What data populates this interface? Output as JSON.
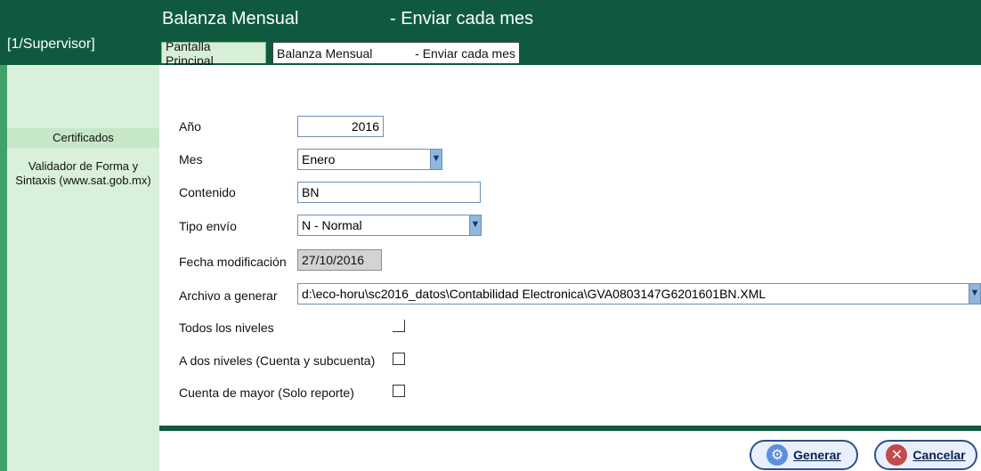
{
  "header": {
    "title_left": "Balanza Mensual",
    "title_right": "- Enviar cada mes",
    "user_label": "[1/Supervisor]"
  },
  "tabs": [
    {
      "label": "Pantalla Principal"
    },
    {
      "label_left": "Balanza Mensual",
      "label_right": "- Enviar cada mes"
    }
  ],
  "sidebar": {
    "items": [
      {
        "label": "Certificados"
      },
      {
        "label": "Validador de Forma y Sintaxis (www.sat.gob.mx)"
      }
    ]
  },
  "form": {
    "year_label": "Año",
    "year_value": "2016",
    "month_label": "Mes",
    "month_value": "Enero",
    "content_label": "Contenido",
    "content_value": "BN",
    "send_type_label": "Tipo envío",
    "send_type_value": "N - Normal",
    "modified_label": "Fecha modificación",
    "modified_value": "27/10/2016",
    "file_label": "Archivo a generar",
    "file_value": "d:\\eco-horu\\sc2016_datos\\Contabilidad Electronica\\GVA0803147G6201601BN.XML",
    "opt_all_levels": "Todos los niveles",
    "opt_two_levels": "A dos niveles (Cuenta y subcuenta)",
    "opt_major_account": "Cuenta de mayor (Solo reporte)"
  },
  "buttons": {
    "generate": "Generar",
    "cancel": "Cancelar"
  },
  "colors": {
    "header": "#0f5a3f",
    "left_panel": "#d9f0da",
    "accent": "#3fa26a"
  }
}
